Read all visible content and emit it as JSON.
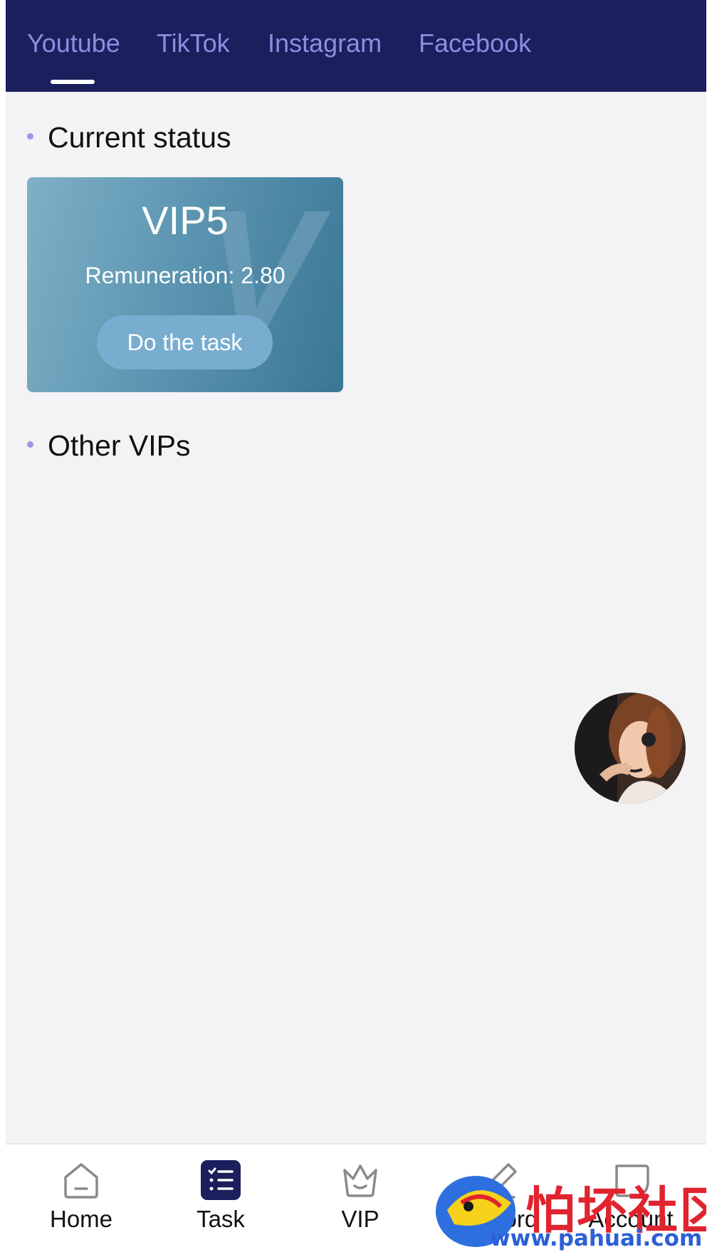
{
  "tabs": [
    {
      "label": "Youtube",
      "active": true
    },
    {
      "label": "TikTok",
      "active": false
    },
    {
      "label": "Instagram",
      "active": false
    },
    {
      "label": "Facebook",
      "active": false
    }
  ],
  "current_status": {
    "title": "Current status",
    "card": {
      "level": "VIP5",
      "watermark_letter": "V",
      "remuneration": "Remuneration: 2.80",
      "button_label": "Do the task"
    }
  },
  "other_vips": {
    "title": "Other VIPs"
  },
  "bottom_nav": [
    {
      "label": "Home",
      "icon": "home-icon",
      "active": false
    },
    {
      "label": "Task",
      "icon": "task-list-icon",
      "active": true
    },
    {
      "label": "VIP",
      "icon": "crown-icon",
      "active": false
    },
    {
      "label": "Record",
      "icon": "pencil-icon",
      "active": false
    },
    {
      "label": "Account",
      "icon": "account-icon",
      "active": false
    }
  ],
  "watermark": {
    "chinese_text": "怕坏社区",
    "url": "www.pahuai.com"
  },
  "colors": {
    "header_bg": "#1b1f5e",
    "tab_text": "#8a8fe0",
    "page_bg": "#f3f2f4",
    "active_icon_bg": "#1b1f5e",
    "inactive_icon": "#8a8a8a"
  }
}
